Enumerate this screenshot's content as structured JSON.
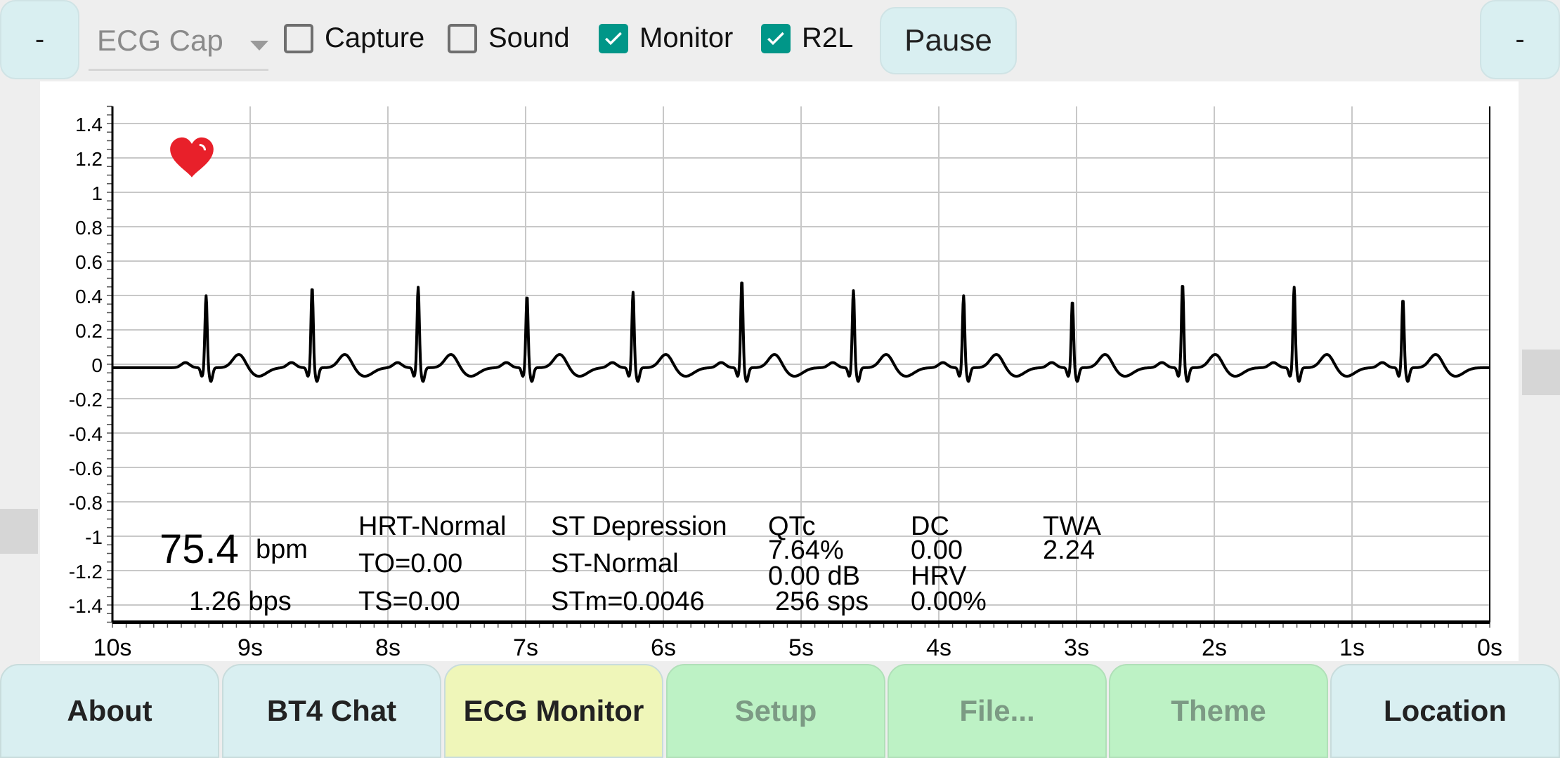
{
  "toolbar": {
    "left_button": "-",
    "right_button": "-",
    "dropdown_value": "ECG Cap",
    "checkboxes": [
      {
        "label": "Capture",
        "checked": false
      },
      {
        "label": "Sound",
        "checked": false
      },
      {
        "label": "Monitor",
        "checked": true
      },
      {
        "label": "R2L",
        "checked": true
      }
    ],
    "pause_label": "Pause",
    "accent_color": "#009688"
  },
  "stats": {
    "bpm_value": "75.4",
    "bpm_unit": "bpm",
    "bps": "1.26 bps",
    "hrt": "HRT-Normal",
    "to": "TO=0.00",
    "ts": "TS=0.00",
    "st_depression": "ST Depression",
    "st_normal": "ST-Normal",
    "stm": "STm=0.0046",
    "qtc_label": "QTc",
    "qtc_value": "7.64%",
    "db": "0.00 dB",
    "sps": "256 sps",
    "dc_label": "DC",
    "dc_value": "0.00",
    "hrv_label": "HRV",
    "hrv_value": "0.00%",
    "twa_label": "TWA",
    "twa_value": "2.24"
  },
  "heart_icon": {
    "name": "heart-icon",
    "color": "#e8202a"
  },
  "chart_data": {
    "type": "line",
    "title": "",
    "xlabel": "",
    "ylabel": "",
    "xlim": [
      10,
      0
    ],
    "ylim": [
      -1.5,
      1.5
    ],
    "grid": true,
    "x_ticks": [
      "10s",
      "9s",
      "8s",
      "7s",
      "6s",
      "5s",
      "4s",
      "3s",
      "2s",
      "1s",
      "0s"
    ],
    "y_ticks": [
      "1.4",
      "1.2",
      "1",
      "0.8",
      "0.6",
      "0.4",
      "0.2",
      "0",
      "-0.2",
      "-0.4",
      "-0.6",
      "-0.8",
      "-1",
      "-1.2",
      "-1.4"
    ],
    "r_peak_times_s": [
      9.32,
      8.55,
      7.78,
      6.99,
      6.22,
      5.43,
      4.62,
      3.82,
      3.03,
      2.23,
      1.42,
      0.63
    ],
    "r_peak_amplitudes": [
      0.4,
      0.45,
      0.45,
      0.4,
      0.42,
      0.49,
      0.43,
      0.4,
      0.37,
      0.47,
      0.45,
      0.38
    ],
    "t_wave_amplitude": 0.08,
    "baseline": -0.02,
    "line_color": "#000000"
  },
  "tabs": [
    {
      "label": "About",
      "state": "normal"
    },
    {
      "label": "BT4 Chat",
      "state": "normal"
    },
    {
      "label": "ECG Monitor",
      "state": "active"
    },
    {
      "label": "Setup",
      "state": "disabled"
    },
    {
      "label": "File...",
      "state": "disabled"
    },
    {
      "label": "Theme",
      "state": "disabled"
    },
    {
      "label": "Location",
      "state": "normal"
    }
  ]
}
